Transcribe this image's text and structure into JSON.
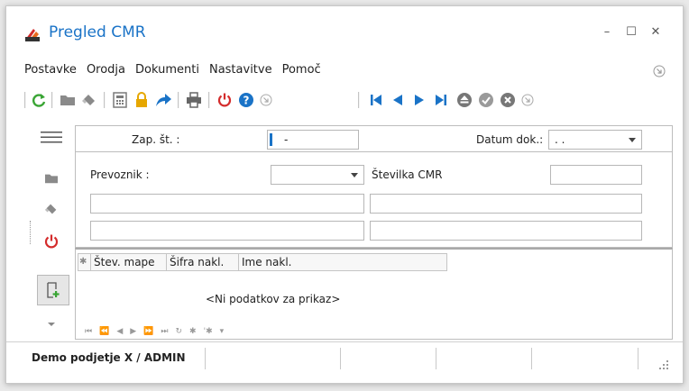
{
  "window": {
    "title": "Pregled CMR",
    "minimize_glyph": "–",
    "maximize_glyph": "☐",
    "close_glyph": "✕"
  },
  "menu": {
    "items": [
      "Postavke",
      "Orodja",
      "Dokumenti",
      "Nastavitve",
      "Pomoč"
    ]
  },
  "toolbar": {
    "icons": [
      "refresh-icon",
      "folder-icon",
      "eraser-icon",
      "calculator-icon",
      "lock-icon",
      "forward-arrow-icon",
      "print-icon",
      "power-icon",
      "help-icon",
      "collapse-icon",
      "first-record-icon",
      "previous-record-icon",
      "next-record-icon",
      "last-record-icon",
      "eject-icon",
      "confirm-icon",
      "cancel-icon",
      "collapse-icon"
    ]
  },
  "form": {
    "zap_st_label": "Zap. št. :",
    "zap_st_value": "-",
    "datum_label": "Datum dok.:",
    "datum_value": ". .",
    "prevoznik_label": "Prevoznik :",
    "prevoznik_value": "",
    "stevilka_cmr_label": "Številka CMR",
    "stevilka_cmr_value": ""
  },
  "grid": {
    "row_indicator": "✱",
    "columns": [
      "Štev. mape",
      "Šifra nakl.",
      "Ime nakl."
    ],
    "empty_text": "<Ni podatkov za prikaz>",
    "nav": [
      "⏮",
      "⏪",
      "◀",
      "▶",
      "⏩",
      "⏭",
      "↻",
      "✱",
      "'✱",
      "▾"
    ]
  },
  "status": {
    "company_user": "Demo podjetje X / ADMIN"
  },
  "colors": {
    "title": "#1a73c7",
    "green": "#3aa535",
    "red": "#d42c2c",
    "blue": "#1a73c7",
    "gray": "#8a8a8a",
    "lock": "#e6a700"
  }
}
